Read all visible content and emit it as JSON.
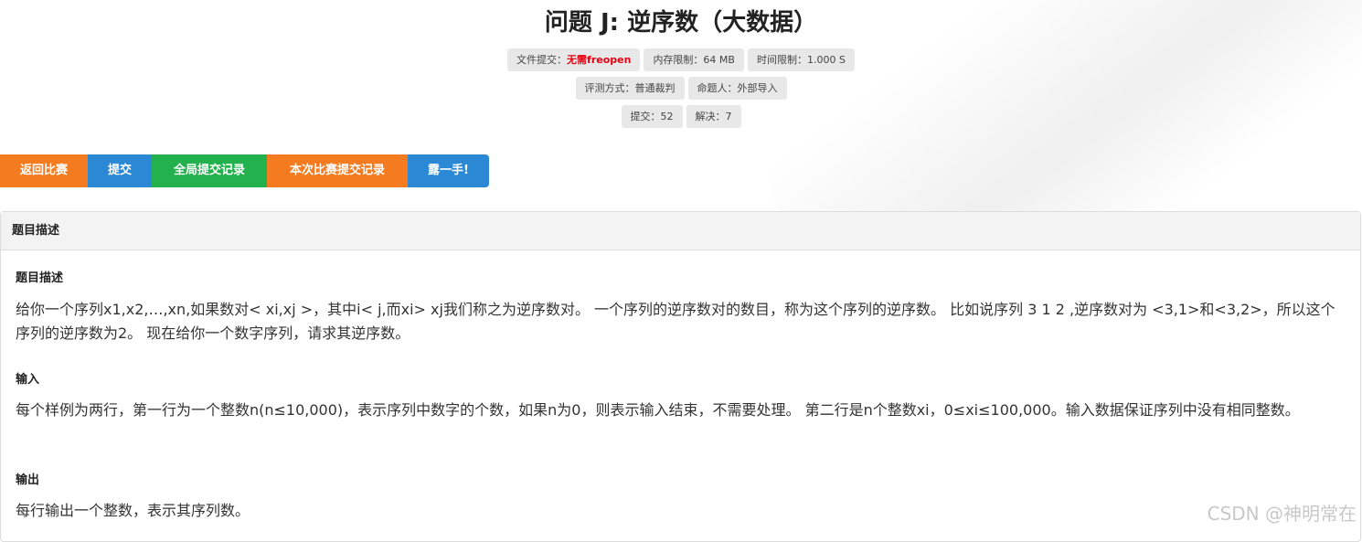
{
  "title": "问题 J: 逆序数（大数据）",
  "meta": {
    "submit_label": "文件提交：",
    "submit_value": "无需freopen",
    "memory": "内存限制：64 MB",
    "time": "时间限制：1.000 S",
    "judge": "评测方式：普通裁判",
    "author": "命题人：外部导入",
    "submissions": "提交：52",
    "solved": "解决：7"
  },
  "buttons": {
    "back": "返回比赛",
    "submit": "提交",
    "global_records": "全局提交记录",
    "contest_records": "本次比赛提交记录",
    "hint": "露一手!"
  },
  "panel": {
    "header": "题目描述",
    "sections": [
      {
        "title": "题目描述",
        "text": "给你一个序列x1,x2,…,xn,如果数对< xi,xj >，其中i< j,而xi> xj我们称之为逆序数对。 一个序列的逆序数对的数目，称为这个序列的逆序数。 比如说序列 3 1 2 ,逆序数对为 <3,1>和<3,2>，所以这个序列的逆序数为2。 现在给你一个数字序列，请求其逆序数。"
      },
      {
        "title": "输入",
        "text": "每个样例为两行，第一行为一个整数n(n≤10,000)，表示序列中数字的个数，如果n为0，则表示输入结束，不需要处理。 第二行是n个整数xi，0≤xi≤100,000。输入数据保证序列中没有相同整数。"
      },
      {
        "title": "输出",
        "text": "每行输出一个整数，表示其序列数。"
      }
    ]
  },
  "watermark": "CSDN @神明常在",
  "colors": {
    "orange": "#f47b20",
    "blue": "#2a88d4",
    "green": "#22b14c",
    "red": "#e60012"
  }
}
